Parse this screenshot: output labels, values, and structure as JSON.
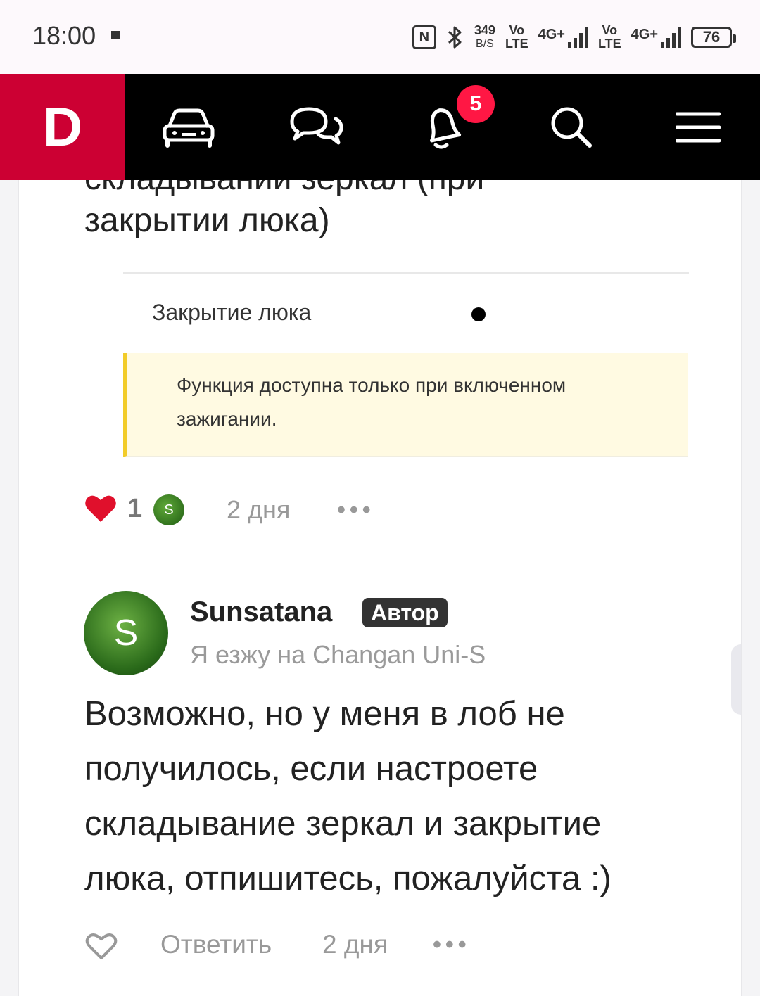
{
  "status": {
    "time": "18:00",
    "speed_value": "349",
    "speed_unit": "B/S",
    "vo1": "Vo",
    "lte1": "LTE",
    "net1": "4G+",
    "vo2": "Vo",
    "lte2": "LTE",
    "net2": "4G+",
    "battery": "76"
  },
  "nav": {
    "logo": "D",
    "notifications_count": "5"
  },
  "post": {
    "heading_cut": "складывании зеркал (при",
    "heading": "закрытии люка)",
    "row_label": "Закрытие люка",
    "note": "Функция доступна только при включенном зажигании.",
    "likes": "1",
    "liker_initial": "S",
    "date": "2 дня",
    "more": "•••"
  },
  "comment": {
    "avatar_initial": "S",
    "author": "Sunsatana",
    "badge": "Автор",
    "subtitle": "Я езжу на Changan Uni-S",
    "text": "Возможно, но у меня в лоб не получилось, если настроете складывание зеркал и закрытие люка, отпишитесь, пожалуйста :)",
    "reply": "Ответить",
    "date": "2 дня",
    "more": "•••"
  },
  "colors": {
    "brand": "#cc0033",
    "badge": "#ff1744",
    "note_bg": "#fffae2",
    "note_border": "#f2cc29",
    "heart": "#e0102c"
  }
}
